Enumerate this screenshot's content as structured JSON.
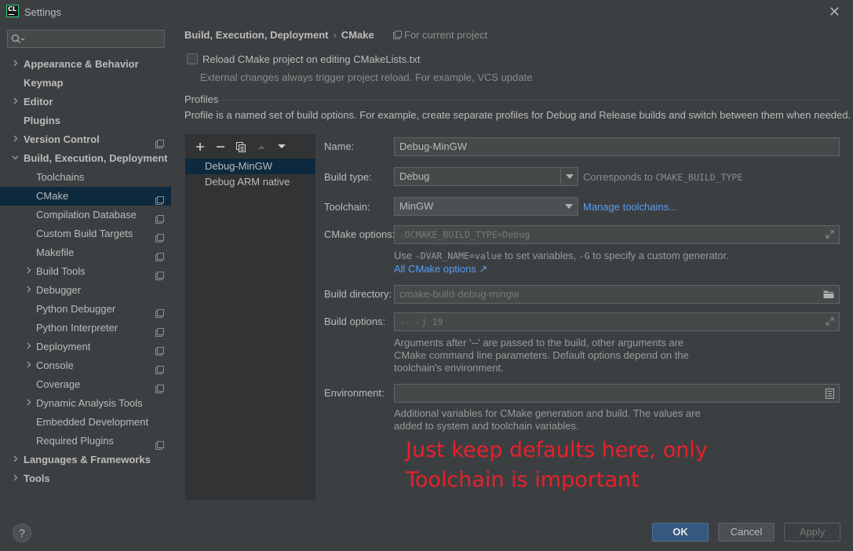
{
  "window": {
    "title": "Settings",
    "logo_text": "CL"
  },
  "search": {
    "placeholder": "",
    "value": ""
  },
  "sidebar": {
    "items": [
      {
        "label": "Appearance & Behavior",
        "level": 0,
        "expandable": true,
        "expanded": false,
        "project_icon": false
      },
      {
        "label": "Keymap",
        "level": 0,
        "expandable": false,
        "project_icon": false
      },
      {
        "label": "Editor",
        "level": 0,
        "expandable": true,
        "expanded": false,
        "project_icon": false
      },
      {
        "label": "Plugins",
        "level": 0,
        "expandable": false,
        "project_icon": false
      },
      {
        "label": "Version Control",
        "level": 0,
        "expandable": true,
        "expanded": false,
        "project_icon": true
      },
      {
        "label": "Build, Execution, Deployment",
        "level": 0,
        "expandable": true,
        "expanded": true,
        "project_icon": false
      },
      {
        "label": "Toolchains",
        "level": 1,
        "expandable": false,
        "project_icon": false
      },
      {
        "label": "CMake",
        "level": 1,
        "expandable": false,
        "project_icon": true,
        "selected": true
      },
      {
        "label": "Compilation Database",
        "level": 1,
        "expandable": false,
        "project_icon": true
      },
      {
        "label": "Custom Build Targets",
        "level": 1,
        "expandable": false,
        "project_icon": true
      },
      {
        "label": "Makefile",
        "level": 1,
        "expandable": false,
        "project_icon": true
      },
      {
        "label": "Build Tools",
        "level": 1,
        "expandable": true,
        "expanded": false,
        "project_icon": true
      },
      {
        "label": "Debugger",
        "level": 1,
        "expandable": true,
        "expanded": false,
        "project_icon": false
      },
      {
        "label": "Python Debugger",
        "level": 1,
        "expandable": false,
        "project_icon": true
      },
      {
        "label": "Python Interpreter",
        "level": 1,
        "expandable": false,
        "project_icon": true
      },
      {
        "label": "Deployment",
        "level": 1,
        "expandable": true,
        "expanded": false,
        "project_icon": true
      },
      {
        "label": "Console",
        "level": 1,
        "expandable": true,
        "expanded": false,
        "project_icon": true
      },
      {
        "label": "Coverage",
        "level": 1,
        "expandable": false,
        "project_icon": true
      },
      {
        "label": "Dynamic Analysis Tools",
        "level": 1,
        "expandable": true,
        "expanded": false,
        "project_icon": false
      },
      {
        "label": "Embedded Development",
        "level": 1,
        "expandable": false,
        "project_icon": false
      },
      {
        "label": "Required Plugins",
        "level": 1,
        "expandable": false,
        "project_icon": true
      },
      {
        "label": "Languages & Frameworks",
        "level": 0,
        "expandable": true,
        "expanded": false,
        "project_icon": false
      },
      {
        "label": "Tools",
        "level": 0,
        "expandable": true,
        "expanded": false,
        "project_icon": false
      }
    ]
  },
  "header": {
    "breadcrumb_parent": "Build, Execution, Deployment",
    "breadcrumb_sep": "›",
    "breadcrumb_current": "CMake",
    "scope": "For current project"
  },
  "reload": {
    "label": "Reload CMake project on editing CMakeLists.txt",
    "checked": false,
    "hint": "External changes always trigger project reload. For example, VCS update"
  },
  "profiles": {
    "title": "Profiles",
    "description": "Profile is a named set of build options. For example, create separate profiles for Debug and Release builds and switch between them when needed.",
    "list": [
      "Debug-MinGW",
      "Debug ARM native"
    ],
    "selected_index": 0
  },
  "form": {
    "name_label": "Name:",
    "name_value": "Debug-MinGW",
    "build_type_label": "Build type:",
    "build_type_value": "Debug",
    "build_type_hint_prefix": "Corresponds to ",
    "build_type_hint_code": "CMAKE_BUILD_TYPE",
    "toolchain_label": "Toolchain:",
    "toolchain_value": "MinGW",
    "manage_toolchains": "Manage toolchains...",
    "cmake_options_label": "CMake options:",
    "cmake_options_placeholder": "-DCMAKE_BUILD_TYPE=Debug",
    "cmake_hint_1": "Use ",
    "cmake_hint_code_1": "-DVAR_NAME=value",
    "cmake_hint_2": " to set variables, ",
    "cmake_hint_code_2": "-G",
    "cmake_hint_3": " to specify a custom generator.",
    "all_cmake_options": "All CMake options ↗",
    "build_dir_label": "Build directory:",
    "build_dir_placeholder": "cmake-build-debug-mingw",
    "build_options_label": "Build options:",
    "build_options_placeholder": "-- -j 19",
    "build_options_hint_1": "Arguments after '--' are passed to the build, other arguments are",
    "build_options_hint_2": "CMake command line parameters. Default options depend on the",
    "build_options_hint_3": "toolchain's environment.",
    "env_label": "Environment:",
    "env_value": "",
    "env_hint_1": "Additional variables for CMake generation and build. The values are",
    "env_hint_2": "added to system and toolchain variables."
  },
  "annotation": {
    "line1": "Just keep defaults here, only",
    "line2": "Toolchain is important",
    "color": "#e8202a"
  },
  "footer": {
    "help": "?",
    "ok": "OK",
    "cancel": "Cancel",
    "apply": "Apply"
  },
  "colors": {
    "background": "#3c3f41",
    "selection": "#0d293e",
    "link": "#589df6",
    "ok_button": "#365880"
  }
}
